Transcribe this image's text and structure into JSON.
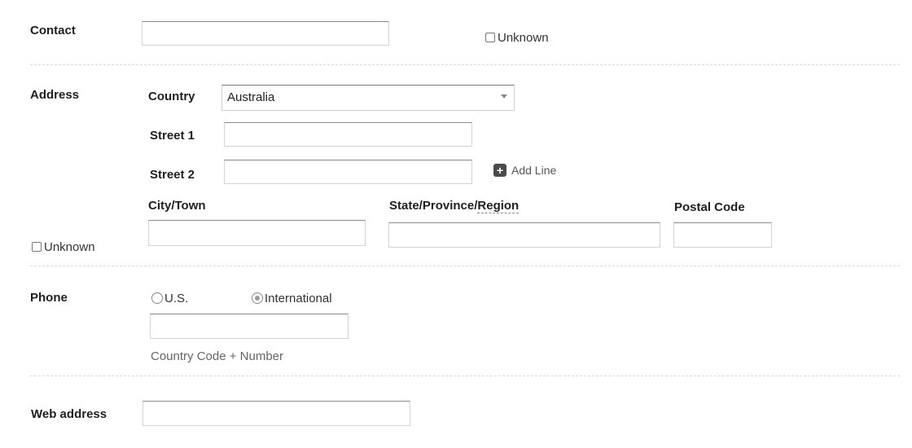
{
  "contact": {
    "label": "Contact",
    "value": "",
    "unknown_label": "Unknown"
  },
  "address": {
    "label": "Address",
    "country_label": "Country",
    "country_value": "Australia",
    "street1_label": "Street 1",
    "street1_value": "",
    "street2_label": "Street 2",
    "street2_value": "",
    "add_line_label": "Add Line",
    "city_label": "City/Town",
    "city_value": "",
    "state_label_part1": "State/Province/",
    "state_label_part2": "Region",
    "state_value": "",
    "postal_label": "Postal Code",
    "postal_value": "",
    "unknown_label": "Unknown"
  },
  "phone": {
    "label": "Phone",
    "option_us": "U.S.",
    "option_international": "International",
    "selected": "International",
    "value": "",
    "hint": "Country Code + Number"
  },
  "web": {
    "label": "Web address",
    "value": ""
  },
  "icons": {
    "add_line": "plus-square-icon",
    "dropdown": "chevron-down-icon"
  }
}
